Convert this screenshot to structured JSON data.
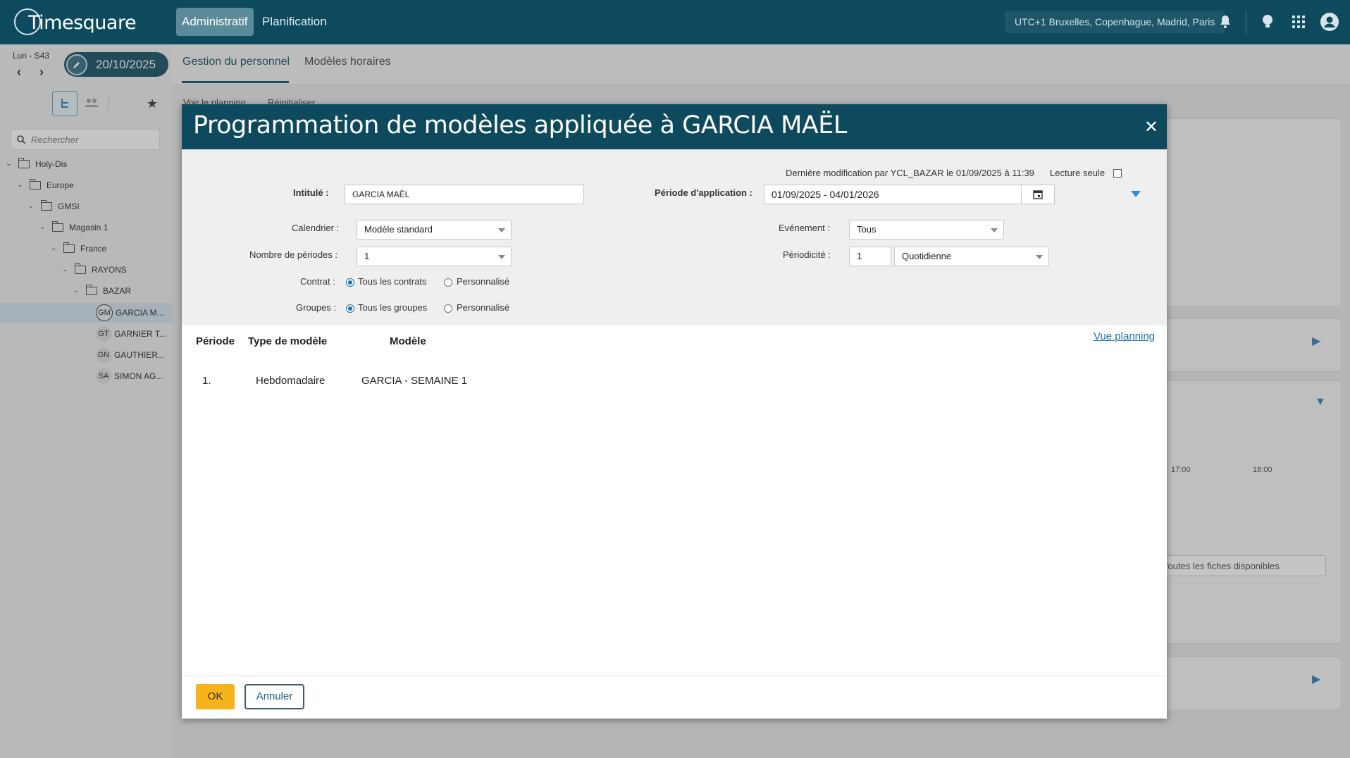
{
  "app": {
    "logo_text": "Timesquare"
  },
  "topbar": {
    "tabs": [
      {
        "label": "Administratif"
      },
      {
        "label": "Planification"
      }
    ],
    "timezone": "UTC+1 Bruxelles, Copenhague, Madrid, Paris",
    "icons": [
      "bell-icon",
      "lightbulb-icon",
      "apps-grid-icon",
      "user-account-icon"
    ]
  },
  "sidebar": {
    "day_label": "Lun - S43",
    "date": "20/10/2025",
    "search_placeholder": "Rechercher",
    "tree": [
      {
        "label": "Holy-Dis",
        "level": 0,
        "type": "folder"
      },
      {
        "label": "Europe",
        "level": 1,
        "type": "folder"
      },
      {
        "label": "GMSI",
        "level": 2,
        "type": "folder"
      },
      {
        "label": "Magasin 1",
        "level": 3,
        "type": "folder"
      },
      {
        "label": "France",
        "level": 4,
        "type": "folder"
      },
      {
        "label": "RAYONS",
        "level": 5,
        "type": "folder"
      },
      {
        "label": "BAZAR",
        "level": 6,
        "type": "folder"
      },
      {
        "label": "GARCIA M...",
        "initials": "GM",
        "type": "person",
        "selected": true
      },
      {
        "label": "GARNIER T...",
        "initials": "GT",
        "type": "person"
      },
      {
        "label": "GAUTHIER...",
        "initials": "GN",
        "type": "person"
      },
      {
        "label": "SIMON AG...",
        "initials": "SA",
        "type": "person"
      }
    ]
  },
  "main": {
    "subtabs": [
      {
        "label": "Gestion du personnel"
      },
      {
        "label": "Modèles horaires"
      }
    ],
    "background_links": [
      "Voir le planning",
      "Réinitialiser"
    ],
    "background_times": [
      "17:00",
      "18:00"
    ],
    "background_select": "Toutes les fiches disponibles"
  },
  "dialog": {
    "title": "Programmation de modèles appliquée à GARCIA MAËL",
    "last_modified": "Dernière modification par YCL_BAZAR le 01/09/2025 à 11:39",
    "read_only_label": "Lecture seule",
    "read_only_checked": false,
    "fields": {
      "intitule_label": "Intitulé :",
      "intitule_value": "GARCIA MAËL",
      "periode_label": "Période d'application :",
      "periode_value": "01/09/2025 - 04/01/2026",
      "calendrier_label": "Calendrier :",
      "calendrier_value": "Modèle standard",
      "nb_periodes_label": "Nombre de périodes :",
      "nb_periodes_value": "1",
      "evenement_label": "Evénement :",
      "evenement_value": "Tous",
      "periodicite_label": "Périodicité :",
      "periodicite_number": "1",
      "periodicite_value": "Quotidienne",
      "contrat_label": "Contrat :",
      "contrat_option_all": "Tous les contrats",
      "contrat_option_custom": "Personnalisé",
      "groupes_label": "Groupes :",
      "groupes_option_all": "Tous les groupes",
      "groupes_option_custom": "Personnalisé"
    },
    "table": {
      "headers": [
        "Période",
        "Type de modèle",
        "Modèle"
      ],
      "rows": [
        {
          "periode": "1.",
          "type": "Hebdomadaire",
          "modele": "GARCIA - SEMAINE 1"
        }
      ]
    },
    "vue_planning_link": "Vue planning",
    "buttons": {
      "ok": "OK",
      "cancel": "Annuler"
    }
  },
  "colors": {
    "primary": "#0d4a5e",
    "accent_button": "#f7b31b",
    "link": "#1a6fb0"
  }
}
